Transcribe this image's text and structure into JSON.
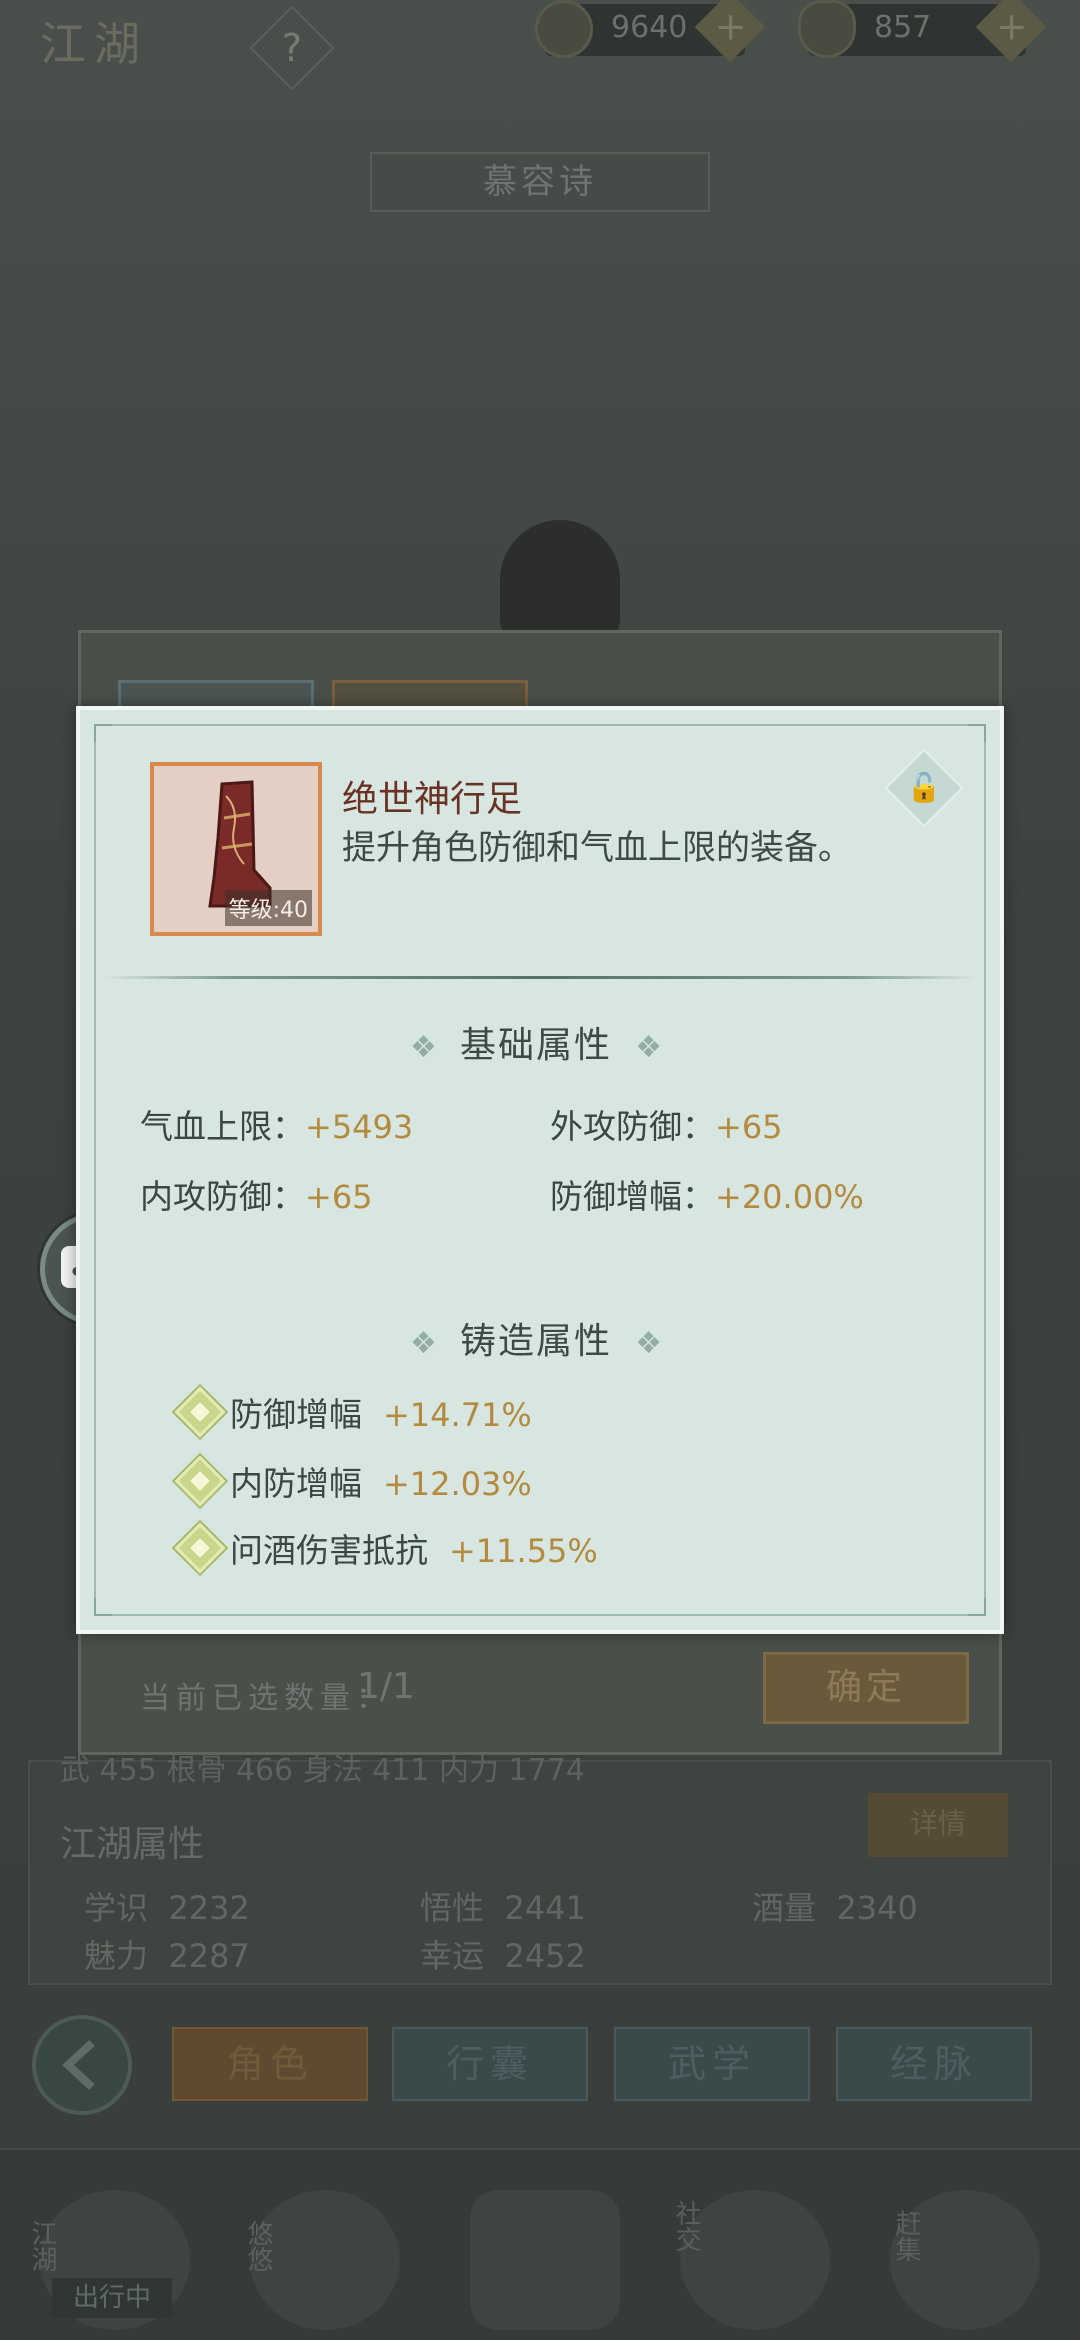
{
  "top_bar": {
    "title": "江湖",
    "help_icon": "?",
    "coins": "9640",
    "ingots": "857",
    "plus": "+"
  },
  "character": {
    "name": "慕容诗"
  },
  "background_panel": {
    "selected_label": "当前已选数量：",
    "selected_count": "1/1",
    "confirm_label": "确定",
    "stats_partial": "武 455      根骨 466      身法 411      内力 1774",
    "jianghu_title": "江湖属性",
    "detail_label": "详情",
    "attrs": [
      {
        "label": "学识",
        "value": "2232"
      },
      {
        "label": "悟性",
        "value": "2441"
      },
      {
        "label": "酒量",
        "value": "2340"
      },
      {
        "label": "魅力",
        "value": "2287"
      },
      {
        "label": "幸运",
        "value": "2452"
      }
    ]
  },
  "bottom_tabs": [
    {
      "label": "角色"
    },
    {
      "label": "行囊"
    },
    {
      "label": "武学"
    },
    {
      "label": "经脉"
    }
  ],
  "dock": [
    {
      "label": "江湖"
    },
    {
      "label": "悠悠"
    },
    {
      "label": "社交"
    },
    {
      "label": "赶集"
    }
  ],
  "dock_badge": "出行中",
  "item": {
    "name": "绝世神行足",
    "description": "提升角色防御和气血上限的装备。",
    "level_label": "等级:40",
    "frame_color": "#d88a4e",
    "icon": "boot-icon"
  },
  "basic_attributes": {
    "title": "基础属性",
    "rows": [
      {
        "label": "气血上限：",
        "value": "+5493"
      },
      {
        "label": "外攻防御：",
        "value": "+65"
      },
      {
        "label": "内攻防御：",
        "value": "+65"
      },
      {
        "label": "防御增幅：",
        "value": "+20.00%"
      }
    ]
  },
  "forge_attributes": {
    "title": "铸造属性",
    "rows": [
      {
        "label": "防御增幅",
        "value": "+14.71%"
      },
      {
        "label": "内防增幅",
        "value": "+12.03%"
      },
      {
        "label": "问酒伤害抵抗",
        "value": "+11.55%"
      }
    ]
  },
  "colors": {
    "popup_bg": "#d8e6e2",
    "value_gold": "#b38a3e",
    "name_red": "#6a3222"
  }
}
